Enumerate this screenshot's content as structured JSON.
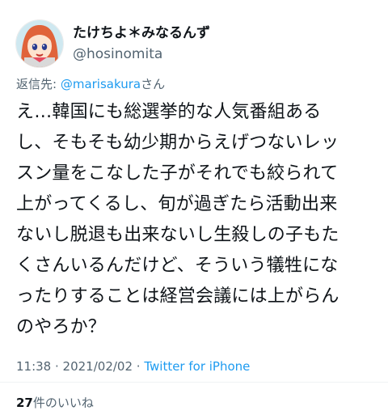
{
  "author": {
    "display_name": "たけちよ＊みなるんず",
    "handle": "@hosinomita",
    "avatar_icon": "user-avatar-illustration"
  },
  "reply": {
    "prefix": "返信先: ",
    "mention": "@marisakura",
    "suffix": "さん"
  },
  "tweet": {
    "lines": [
      "え…韓国にも総選挙的な人気番組ある",
      "し、そもそも幼少期からえげつないレッ",
      "スン量をこなした子がそれでも絞られて",
      "上がってくるし、旬が過ぎたら活動出来",
      "ないし脱退も出来ないし生殺しの子もた",
      "くさんいるんだけど、そういう犠牲にな",
      "ったりすることは経営会議には上がらん",
      "のやろか？"
    ]
  },
  "meta": {
    "time": "11:38",
    "date": "2021/02/02",
    "separator": " · ",
    "source": "Twitter for iPhone"
  },
  "likes": {
    "count": "27",
    "label": "件のいいね"
  },
  "colors": {
    "link": "#1d9bf0",
    "secondary_text": "#536471",
    "primary_text": "#0f1419",
    "avatar_bg": "#cfe8f0"
  }
}
